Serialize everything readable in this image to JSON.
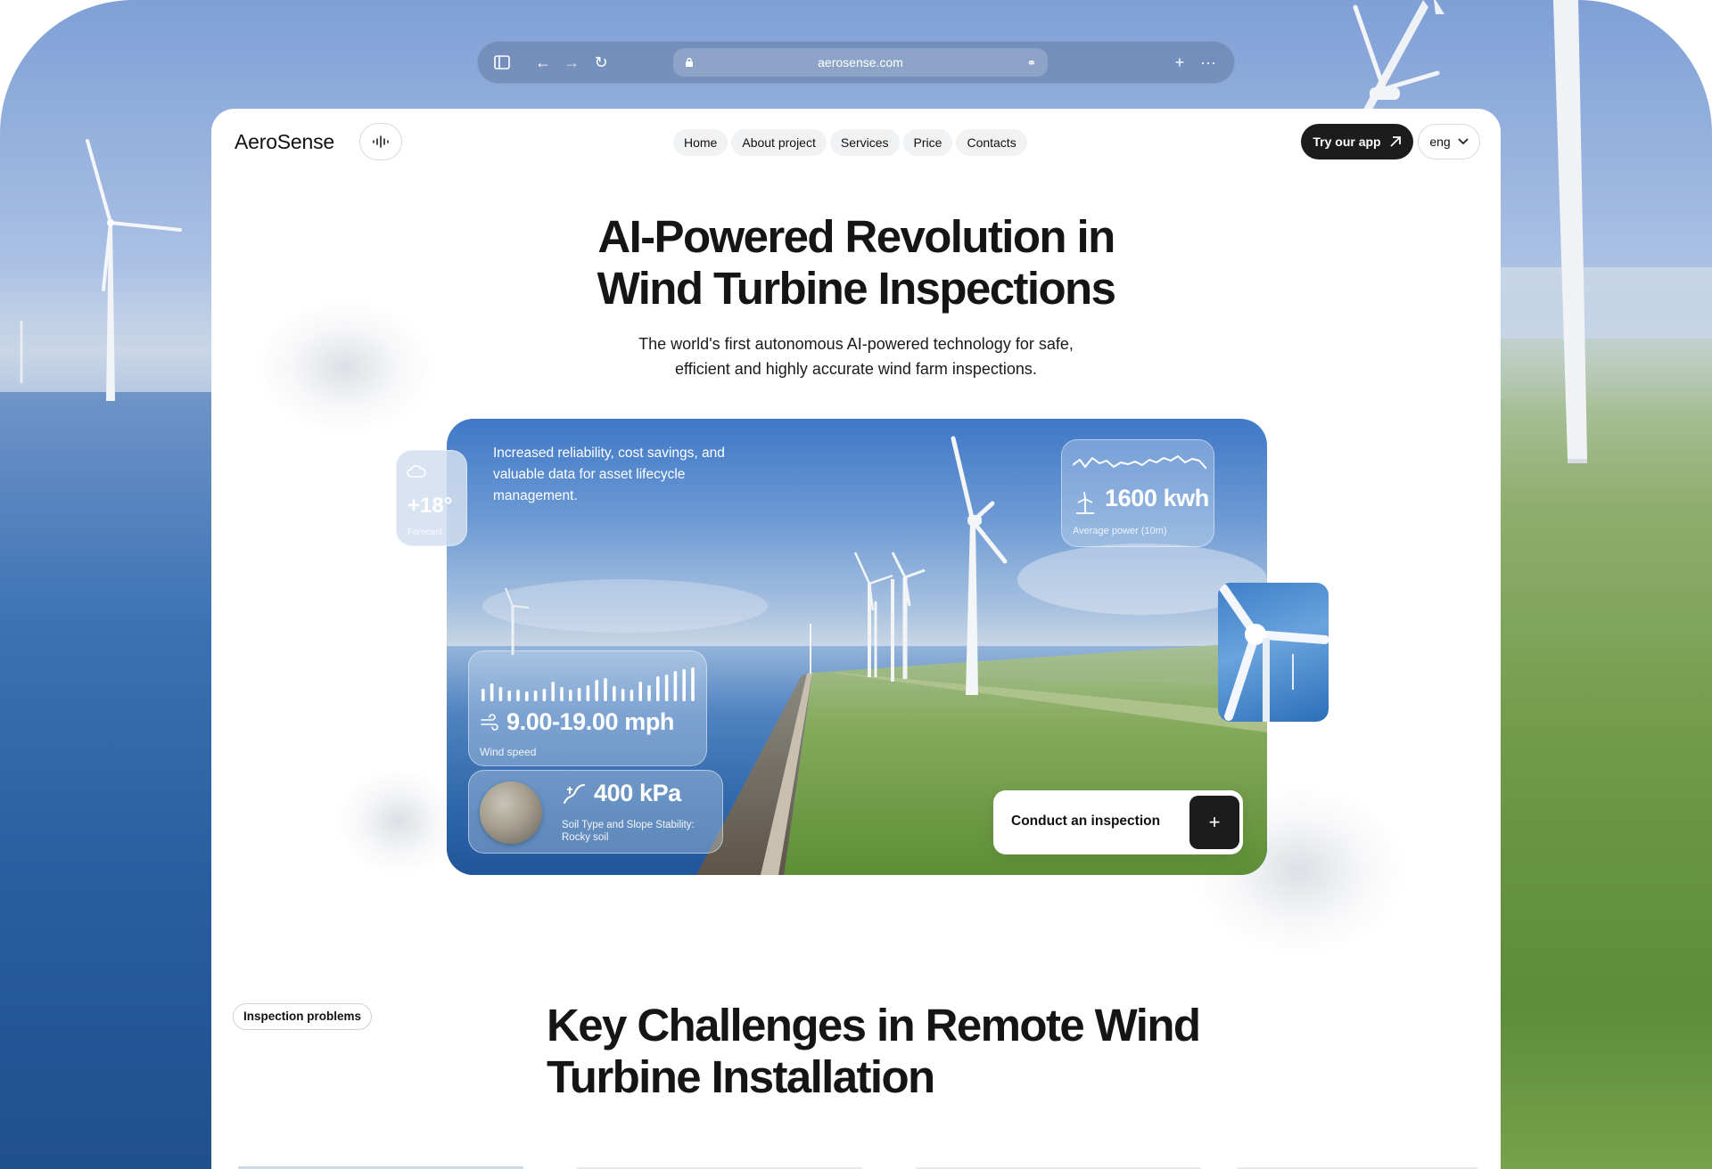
{
  "browser": {
    "url": "aerosense.com"
  },
  "header": {
    "logo": "AeroSense",
    "nav": [
      "Home",
      "About project",
      "Services",
      "Price",
      "Contacts"
    ],
    "try_app_label": "Try our app",
    "language": "eng"
  },
  "hero": {
    "title_line1": "AI-Powered Revolution in",
    "title_line2": "Wind Turbine Inspections",
    "subtitle_line1": "The world's first autonomous AI-powered technology for safe,",
    "subtitle_line2": "efficient and highly accurate wind farm inspections.",
    "tagline": "Increased reliability, cost savings, and valuable data for asset lifecycle management."
  },
  "widgets": {
    "forecast": {
      "value": "+18°",
      "label": "Forecast"
    },
    "power": {
      "value": "1600 kwh",
      "label": "Average power (10m)"
    },
    "wind": {
      "value": "9.00-19.00 mph",
      "label": "Wind speed"
    },
    "soil": {
      "value": "400 kPa",
      "label_line1": "Soil Type and Slope Stability:",
      "label_line2": "Rocky soil"
    }
  },
  "cta": {
    "label": "Conduct an inspection",
    "icon": "plus-icon"
  },
  "section": {
    "badge": "Inspection problems",
    "title_line1": "Key Challenges in Remote Wind",
    "title_line2": "Turbine Installation"
  },
  "colors": {
    "dark": "#1c1c1c",
    "accent_blue": "#3f78c7",
    "field_green": "#6f9a48"
  }
}
